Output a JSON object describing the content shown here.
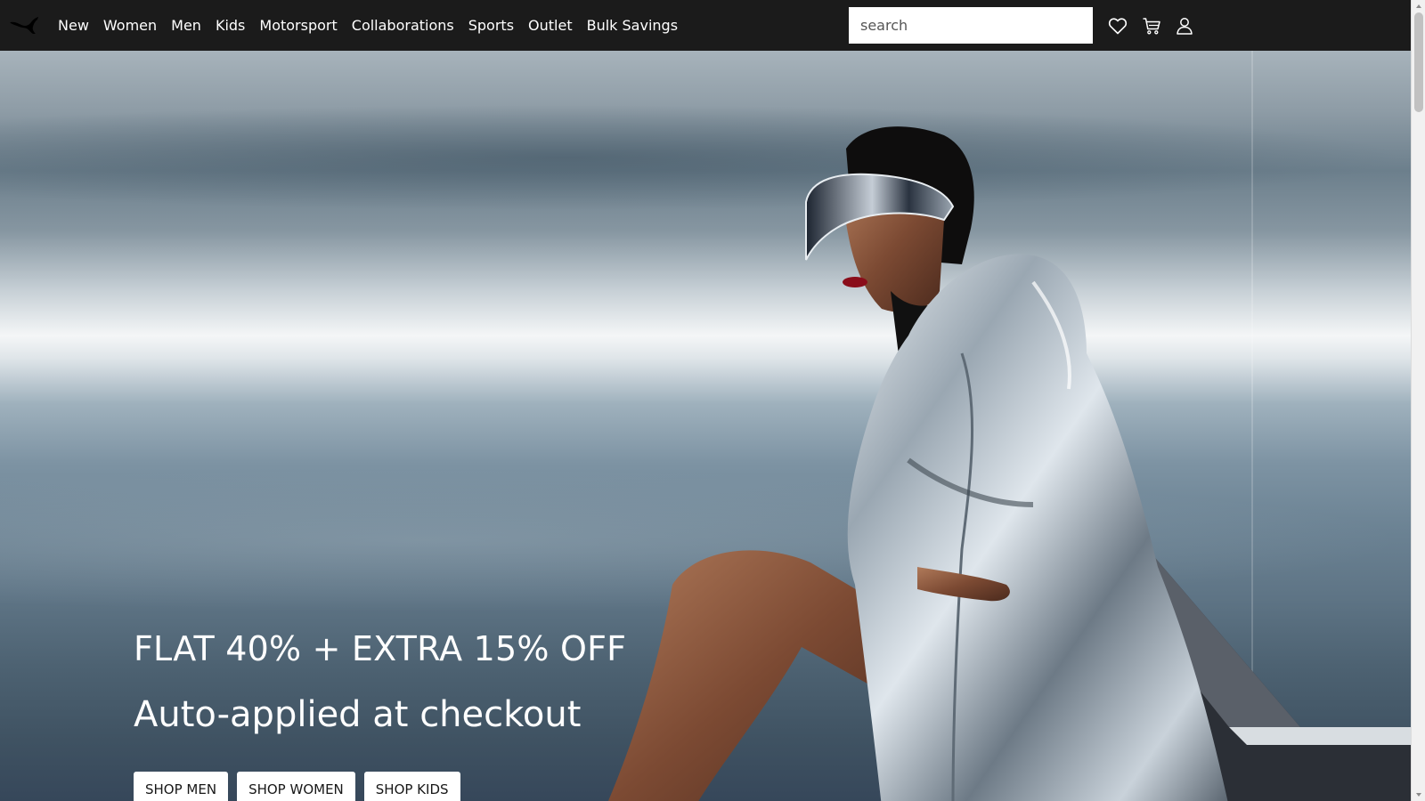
{
  "nav": {
    "logo_icon": "puma-cat-logo-icon",
    "links": [
      {
        "label": "New"
      },
      {
        "label": "Women"
      },
      {
        "label": "Men"
      },
      {
        "label": "Kids"
      },
      {
        "label": "Motorsport"
      },
      {
        "label": "Collaborations"
      },
      {
        "label": "Sports"
      },
      {
        "label": "Outlet"
      },
      {
        "label": "Bulk Savings"
      }
    ],
    "search": {
      "placeholder": "search",
      "value": ""
    },
    "icons": [
      "heart-icon",
      "cart-icon",
      "user-icon"
    ]
  },
  "hero": {
    "headline": "FLAT 40% + EXTRA 15% OFF",
    "subline": "Auto-applied at checkout",
    "buttons": [
      {
        "label": "SHOP MEN"
      },
      {
        "label": "SHOP WOMEN"
      },
      {
        "label": "SHOP KIDS"
      }
    ]
  },
  "colors": {
    "navbar_bg": "#1b1b1b",
    "nav_text": "#ffffff",
    "button_bg": "#ffffff",
    "button_text": "#181818"
  }
}
